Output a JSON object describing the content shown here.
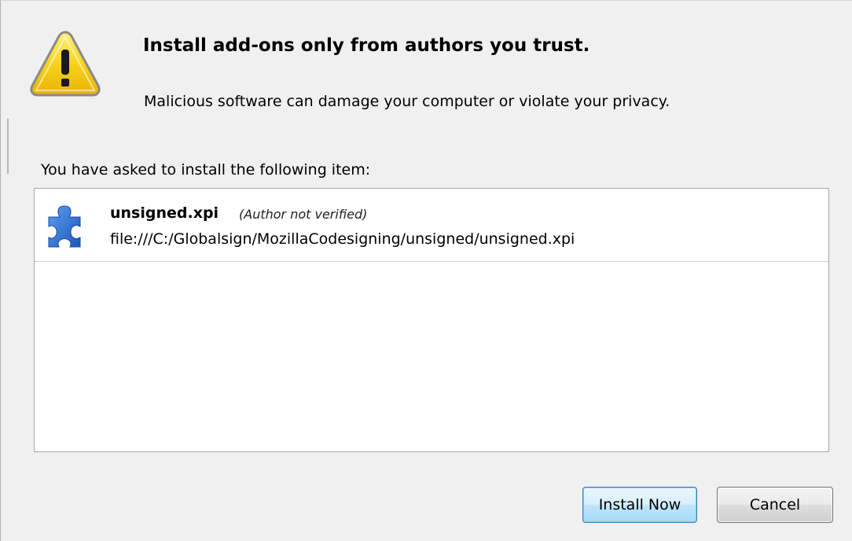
{
  "dialog": {
    "heading": "Install add-ons only from authors you trust.",
    "subtext": "Malicious software can damage your computer or violate your privacy.",
    "asked_label": "You have asked to install the following item:",
    "icon": "warning-triangle-icon"
  },
  "items": [
    {
      "name": "unsigned.xpi",
      "note": "(Author not verified)",
      "path": "file:///C:/Globalsign/MozillaCodesigning/unsigned/unsigned.xpi",
      "icon": "puzzle-piece-icon"
    }
  ],
  "buttons": {
    "install_label": "Install Now",
    "cancel_label": "Cancel"
  },
  "colors": {
    "background": "#f0f0f0",
    "warning_yellow": "#f7d21e",
    "puzzle_blue": "#2b6fd0",
    "install_border": "#3c7fb1"
  }
}
